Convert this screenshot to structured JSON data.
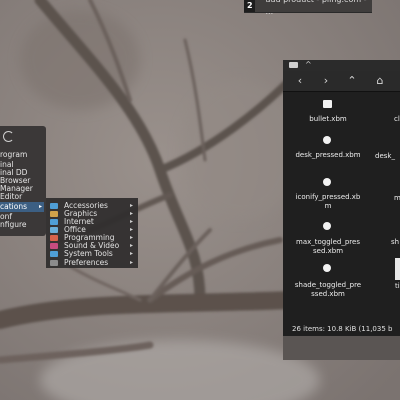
{
  "taskbar": {
    "task_number": "2",
    "task_title": "add product - pling.com - ..."
  },
  "app_menu": {
    "items": [
      {
        "label": "rogram"
      },
      {
        "label": "inal"
      },
      {
        "label": "inal DD"
      },
      {
        "label": "Browser"
      },
      {
        "label": "Manager"
      },
      {
        "label": "Editor"
      },
      {
        "label": "cations",
        "arrow": "▸"
      },
      {
        "label": "onf"
      },
      {
        "label": "nfigure"
      }
    ]
  },
  "applications_submenu": {
    "items": [
      {
        "label": "Accessories",
        "color": "#4f9fd6",
        "arrow": "▸"
      },
      {
        "label": "Graphics",
        "color": "#d0a24a",
        "arrow": "▸"
      },
      {
        "label": "Internet",
        "color": "#4f9fd6",
        "arrow": "▸"
      },
      {
        "label": "Office",
        "color": "#6bb0d8",
        "arrow": "▸"
      },
      {
        "label": "Programming",
        "color": "#d7644b",
        "arrow": "▸"
      },
      {
        "label": "Sound & Video",
        "color": "#c64c7f",
        "arrow": "▸"
      },
      {
        "label": "System Tools",
        "color": "#4f9fd6",
        "arrow": "▸"
      },
      {
        "label": "Preferences",
        "color": "#8c8c8c",
        "arrow": "▸"
      }
    ]
  },
  "file_manager": {
    "toolbar": {
      "back_icon": "‹",
      "forward_icon": "›",
      "up_icon": "⌃",
      "home_icon": "⌂"
    },
    "files": [
      {
        "name_lines": [
          "bullet.xbm"
        ],
        "icon": "bullet-icon"
      },
      {
        "name_lines": [
          "desk_pressed.xbm"
        ],
        "icon": "desk-pressed-icon"
      },
      {
        "name_lines": [
          "iconify_pressed.xb",
          "m"
        ],
        "icon": "iconify-pressed-icon"
      },
      {
        "name_lines": [
          "max_toggled_pres",
          "sed.xbm"
        ],
        "icon": "max-toggled-icon"
      },
      {
        "name_lines": [
          "shade_toggled_pre",
          "ssed.xbm"
        ],
        "icon": "shade-toggled-icon"
      }
    ],
    "clipped_right": [
      "cl",
      "desk_",
      "m",
      "sh",
      "ti"
    ],
    "status": "26 items: 10.8 KiB (11,035 b"
  }
}
